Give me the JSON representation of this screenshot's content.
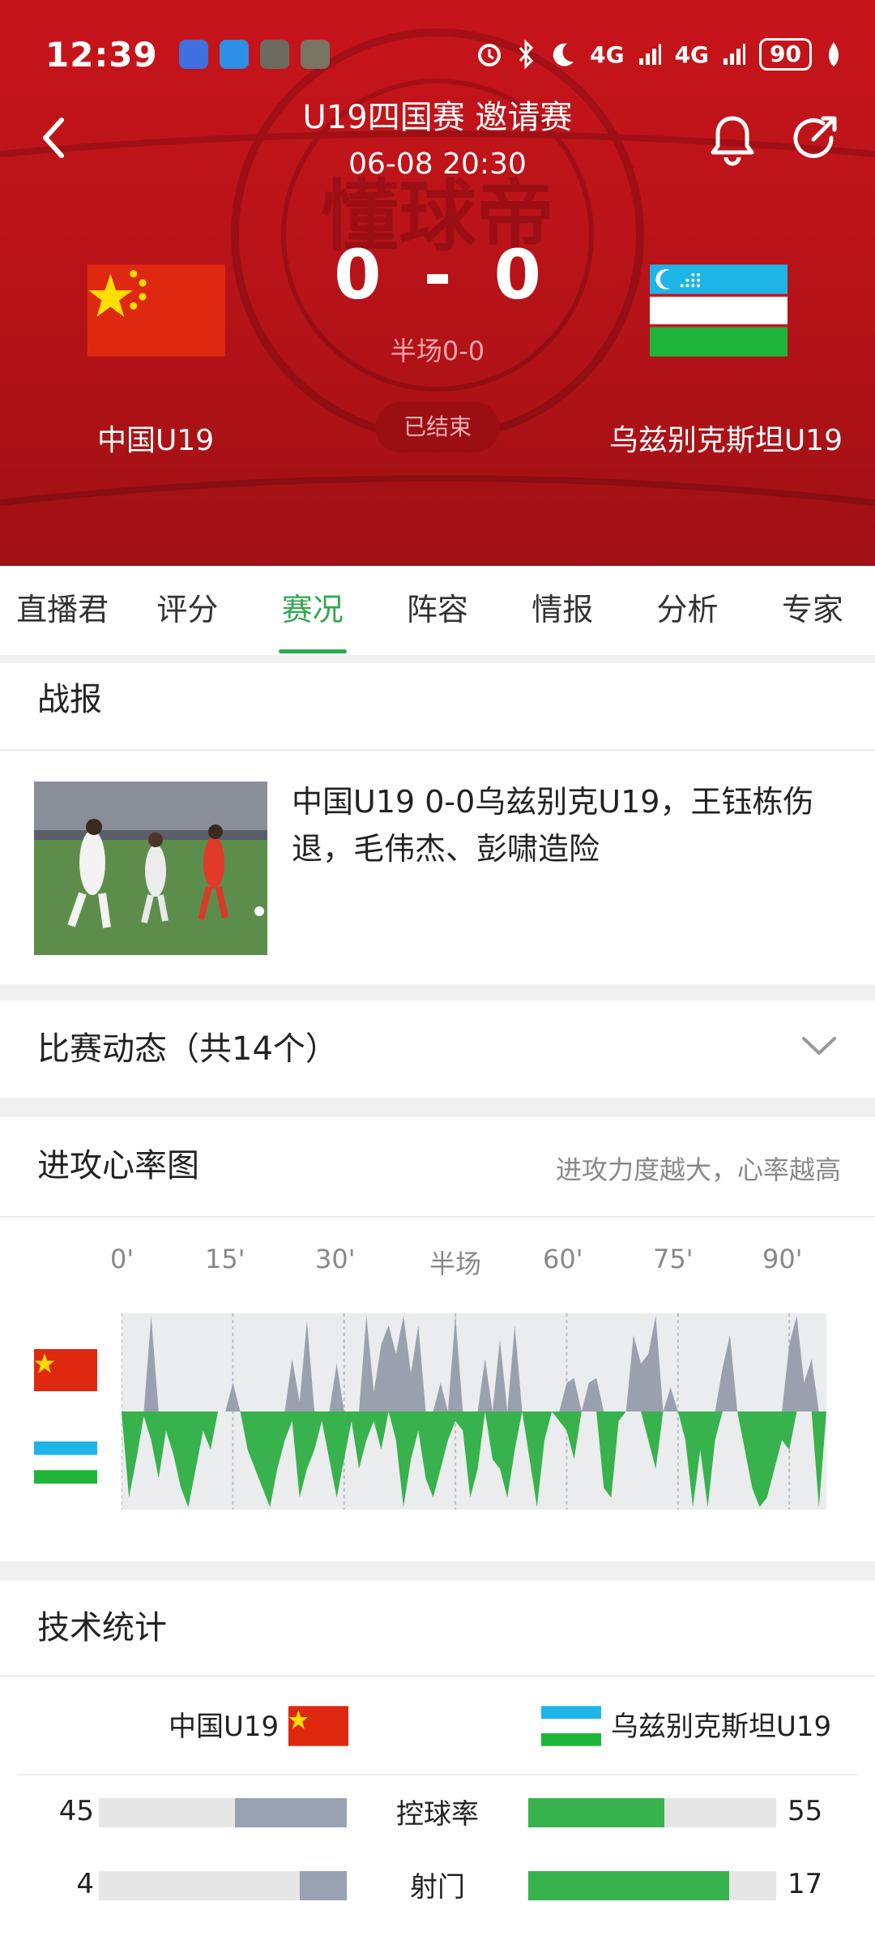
{
  "status_bar": {
    "time": "12:39",
    "net1": "4G",
    "net2": "4G",
    "battery": "90"
  },
  "header": {
    "title": "U19四国赛 邀请赛",
    "datetime": "06-08 20:30",
    "home_score": "0",
    "separator": "-",
    "away_score": "0",
    "halftime": "半场0-0",
    "home_team": "中国U19",
    "away_team": "乌兹别克斯坦U19",
    "status": "已结束",
    "watermark": "懂球帝"
  },
  "tabs": [
    {
      "label": "直播君"
    },
    {
      "label": "评分"
    },
    {
      "label": "赛况",
      "active": true
    },
    {
      "label": "阵容"
    },
    {
      "label": "情报"
    },
    {
      "label": "分析"
    },
    {
      "label": "专家"
    }
  ],
  "report": {
    "section_title": "战报",
    "headline": "中国U19 0-0乌兹别克U19，王钰栋伤退，毛伟杰、彭啸造险"
  },
  "events": {
    "title": "比赛动态（共14个）"
  },
  "heartrate": {
    "title": "进攻心率图",
    "note": "进攻力度越大，心率越高",
    "ticks": [
      "0'",
      "15'",
      "30'",
      "半场",
      "60'",
      "75'",
      "90'"
    ]
  },
  "chart_data": {
    "type": "area",
    "title": "进攻心率图",
    "x_ticks": [
      "0'",
      "15'",
      "30'",
      "半场",
      "60'",
      "75'",
      "90'"
    ],
    "x_range": [
      0,
      95
    ],
    "series": [
      {
        "name": "中国U19",
        "color": "#9aa0ad",
        "values": [
          [
            3,
            0
          ],
          [
            4,
            1
          ],
          [
            5,
            0
          ],
          [
            8,
            0
          ],
          [
            13,
            0
          ],
          [
            14,
            0
          ],
          [
            15,
            0.3
          ],
          [
            16,
            0
          ],
          [
            21,
            0
          ],
          [
            22,
            0
          ],
          [
            23,
            0.55
          ],
          [
            24,
            0.1
          ],
          [
            25,
            0.95
          ],
          [
            26,
            0
          ],
          [
            28,
            0
          ],
          [
            29,
            0.5
          ],
          [
            30,
            0
          ],
          [
            32,
            0
          ],
          [
            33,
            1
          ],
          [
            34,
            0.2
          ],
          [
            35,
            0.7
          ],
          [
            36,
            0.9
          ],
          [
            37,
            0.6
          ],
          [
            38,
            1
          ],
          [
            39,
            0.4
          ],
          [
            40,
            0.9
          ],
          [
            41,
            0
          ],
          [
            42,
            0
          ],
          [
            43,
            0.3
          ],
          [
            44,
            0
          ],
          [
            45,
            1
          ],
          [
            46,
            0
          ],
          [
            48,
            0
          ],
          [
            49,
            0.55
          ],
          [
            50,
            0
          ],
          [
            51,
            0.75
          ],
          [
            52,
            0
          ],
          [
            53,
            0.9
          ],
          [
            54,
            0
          ],
          [
            59,
            0
          ],
          [
            60,
            0.3
          ],
          [
            61,
            0.35
          ],
          [
            62,
            0
          ],
          [
            63,
            0.3
          ],
          [
            64,
            0.35
          ],
          [
            65,
            0
          ],
          [
            68,
            0
          ],
          [
            69,
            0.8
          ],
          [
            70,
            0.5
          ],
          [
            71,
            0.6
          ],
          [
            72,
            1
          ],
          [
            73,
            0
          ],
          [
            74,
            0.25
          ],
          [
            75,
            0
          ],
          [
            80,
            0
          ],
          [
            81,
            0.45
          ],
          [
            82,
            0.8
          ],
          [
            83,
            0
          ],
          [
            89,
            0
          ],
          [
            90,
            0.7
          ],
          [
            91,
            1
          ],
          [
            92,
            0.3
          ],
          [
            93,
            0.55
          ],
          [
            94,
            0
          ]
        ]
      },
      {
        "name": "乌兹别克斯坦U19",
        "color": "#37b24d",
        "values": [
          [
            0,
            0
          ],
          [
            1,
            0.9
          ],
          [
            2,
            0.5
          ],
          [
            3,
            0.05
          ],
          [
            4,
            0.3
          ],
          [
            5,
            0.7
          ],
          [
            6,
            0.2
          ],
          [
            7,
            0.45
          ],
          [
            8,
            0.8
          ],
          [
            9,
            1
          ],
          [
            10,
            0.6
          ],
          [
            11,
            0.2
          ],
          [
            12,
            0.4
          ],
          [
            13,
            0
          ],
          [
            16,
            0
          ],
          [
            17,
            0.4
          ],
          [
            18,
            0.6
          ],
          [
            19,
            0.8
          ],
          [
            20,
            1
          ],
          [
            21,
            0.6
          ],
          [
            22,
            0.3
          ],
          [
            23,
            0.1
          ],
          [
            24,
            0.9
          ],
          [
            25,
            0.6
          ],
          [
            26,
            0.4
          ],
          [
            27,
            0.1
          ],
          [
            28,
            0.5
          ],
          [
            29,
            0.9
          ],
          [
            30,
            0.5
          ],
          [
            31,
            0.1
          ],
          [
            32,
            0.6
          ],
          [
            33,
            0.3
          ],
          [
            34,
            0.1
          ],
          [
            35,
            0.4
          ],
          [
            36,
            0
          ],
          [
            37,
            0.3
          ],
          [
            38,
            1
          ],
          [
            39,
            0.5
          ],
          [
            40,
            0.2
          ],
          [
            41,
            0.7
          ],
          [
            42,
            0.9
          ],
          [
            43,
            0.6
          ],
          [
            44,
            0.3
          ],
          [
            45,
            0.1
          ],
          [
            46,
            0.2
          ],
          [
            47,
            0.9
          ],
          [
            48,
            0.6
          ],
          [
            49,
            0
          ],
          [
            50,
            0.5
          ],
          [
            51,
            0.6
          ],
          [
            52,
            0.9
          ],
          [
            53,
            0.4
          ],
          [
            54,
            0
          ],
          [
            55,
            0.5
          ],
          [
            56,
            1
          ],
          [
            57,
            0.3
          ],
          [
            58,
            0
          ],
          [
            60,
            0.2
          ],
          [
            61,
            0.5
          ],
          [
            62,
            0
          ],
          [
            64,
            0
          ],
          [
            65,
            0.8
          ],
          [
            66,
            0.9
          ],
          [
            67,
            0.1
          ],
          [
            68,
            0
          ],
          [
            70,
            0
          ],
          [
            71,
            0.3
          ],
          [
            72,
            0.6
          ],
          [
            73,
            0
          ],
          [
            75,
            0
          ],
          [
            76,
            0.3
          ],
          [
            77,
            1
          ],
          [
            78,
            0.4
          ],
          [
            79,
            1
          ],
          [
            80,
            0.3
          ],
          [
            81,
            0
          ],
          [
            83,
            0
          ],
          [
            84,
            0.4
          ],
          [
            85,
            0.8
          ],
          [
            86,
            1
          ],
          [
            87,
            0.9
          ],
          [
            88,
            0.6
          ],
          [
            89,
            0.3
          ],
          [
            90,
            0.4
          ],
          [
            91,
            0
          ],
          [
            93,
            0
          ],
          [
            94,
            1
          ],
          [
            95,
            0
          ]
        ]
      }
    ]
  },
  "stats": {
    "title": "技术统计",
    "home_team": "中国U19",
    "away_team": "乌兹别克斯坦U19",
    "rows": [
      {
        "label": "控球率",
        "home": "45",
        "away": "55",
        "home_pct": 45,
        "away_pct": 55
      },
      {
        "label": "射门",
        "home": "4",
        "away": "17",
        "home_pct": 19,
        "away_pct": 81
      }
    ]
  },
  "colors": {
    "header_red": "#c7141b",
    "accent_green": "#2fa84f",
    "home_bar": "#98a2b3",
    "away_bar": "#37b24d"
  }
}
